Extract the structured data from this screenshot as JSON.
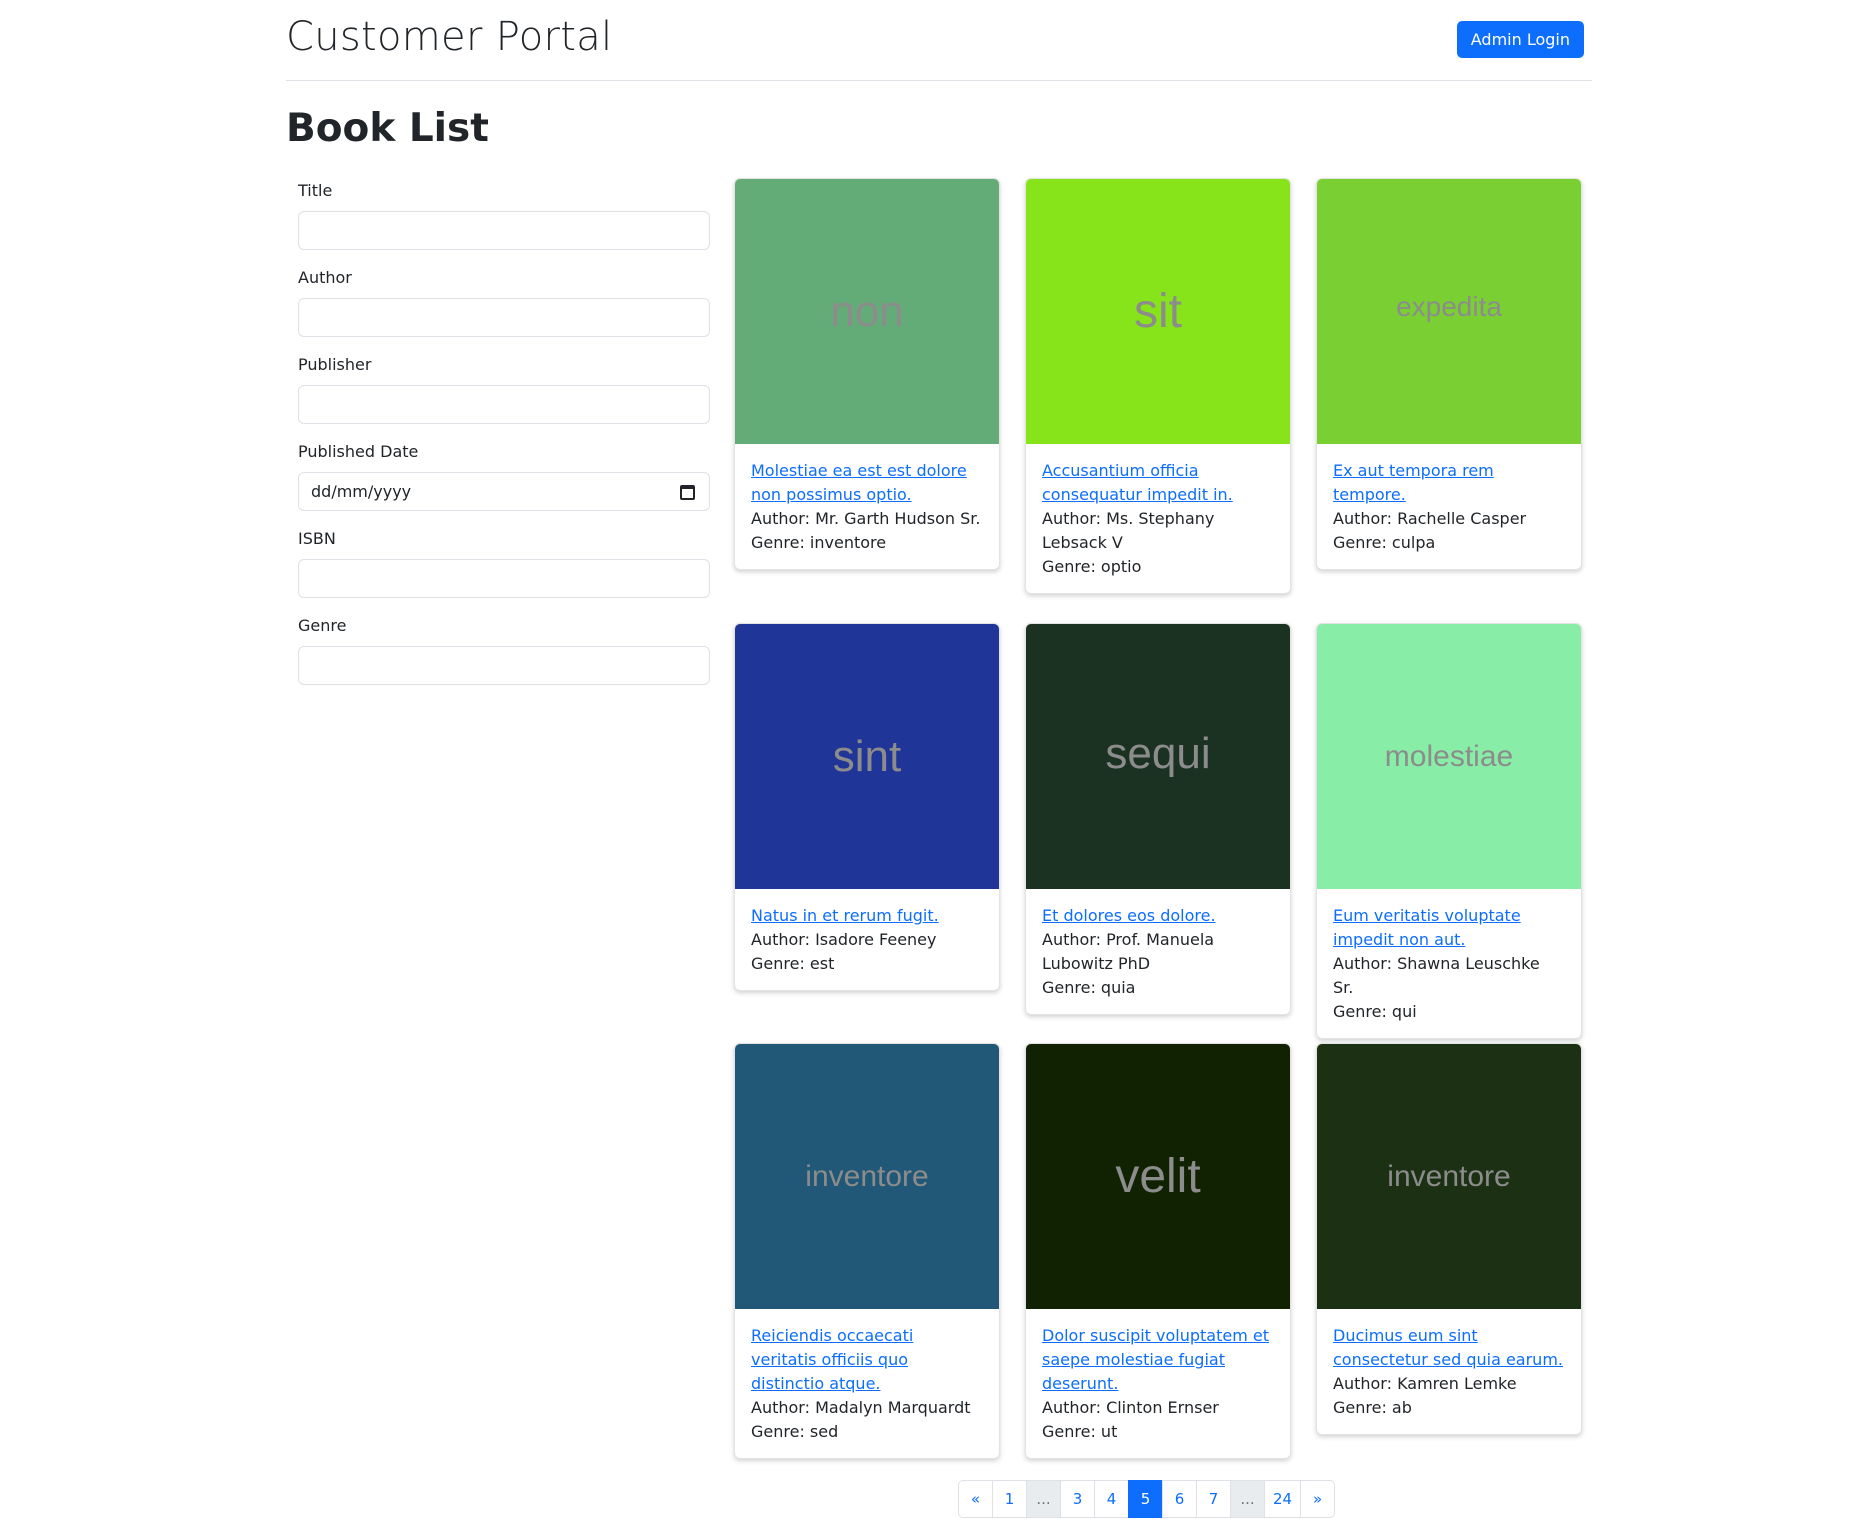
{
  "header": {
    "brand": "Customer Portal",
    "admin_login": "Admin Login"
  },
  "page_title": "Book List",
  "filters": {
    "title_label": "Title",
    "author_label": "Author",
    "publisher_label": "Publisher",
    "published_date_label": "Published Date",
    "published_date_placeholder": "dd/mm/yyyy",
    "isbn_label": "ISBN",
    "genre_label": "Genre"
  },
  "books": [
    {
      "cover_text": "non",
      "cover_color": "#64ac77",
      "title": "Molestiae ea est est dolore non possimus optio.",
      "author": "Author: Mr. Garth Hudson Sr.",
      "genre": "Genre: inventore"
    },
    {
      "cover_text": "sit",
      "cover_color": "#87e31a",
      "title": "Accusantium officia consequatur impedit in.",
      "author": "Author: Ms. Stephany Lebsack V",
      "genre": "Genre: optio"
    },
    {
      "cover_text": "expedita",
      "cover_color": "#7acf32",
      "title": "Ex aut tempora rem tempore.",
      "author": "Author: Rachelle Casper",
      "genre": "Genre: culpa"
    },
    {
      "cover_text": "sint",
      "cover_color": "#1f3597",
      "title": "Natus in et rerum fugit.",
      "author": "Author: Isadore Feeney",
      "genre": "Genre: est"
    },
    {
      "cover_text": "sequi",
      "cover_color": "#1b3223",
      "title": "Et dolores eos dolore.",
      "author": "Author: Prof. Manuela Lubowitz PhD",
      "genre": "Genre: quia"
    },
    {
      "cover_text": "molestiae",
      "cover_color": "#88eda6",
      "title": "Eum veritatis voluptate impedit non aut.",
      "author": "Author: Shawna Leuschke Sr.",
      "genre": "Genre: qui"
    },
    {
      "cover_text": "inventore",
      "cover_color": "#225877",
      "title": "Reiciendis occaecati veritatis officiis quo distinctio atque.",
      "author": "Author: Madalyn Marquardt",
      "genre": "Genre: sed"
    },
    {
      "cover_text": "velit",
      "cover_color": "#102202",
      "title": "Dolor suscipit voluptatem et saepe molestiae fugiat deserunt.",
      "author": "Author: Clinton Ernser",
      "genre": "Genre: ut"
    },
    {
      "cover_text": "inventore",
      "cover_color": "#1c3013",
      "title": "Ducimus eum sint consectetur sed quia earum.",
      "author": "Author: Kamren Lemke",
      "genre": "Genre: ab"
    }
  ],
  "pagination": {
    "items": [
      "«",
      "1",
      "...",
      "3",
      "4",
      "5",
      "6",
      "7",
      "...",
      "24",
      "»"
    ],
    "active": "5"
  }
}
